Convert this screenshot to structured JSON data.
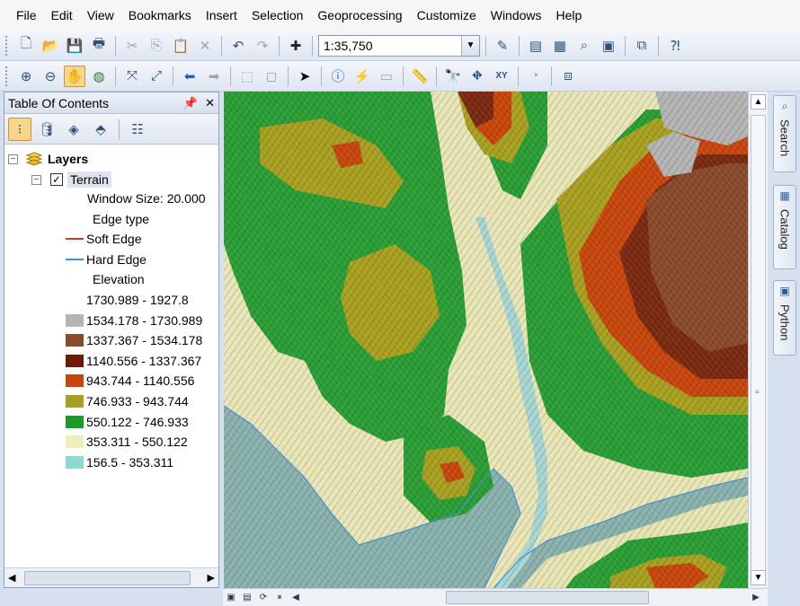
{
  "menu": [
    "File",
    "Edit",
    "View",
    "Bookmarks",
    "Insert",
    "Selection",
    "Geoprocessing",
    "Customize",
    "Windows",
    "Help"
  ],
  "toolbar": {
    "scale_value": "1:35,750",
    "icons_row1": [
      "new-icon",
      "open-icon",
      "save-icon",
      "print-icon",
      "cut-icon",
      "copy-icon",
      "paste-icon",
      "delete-icon",
      "undo-icon",
      "redo-icon",
      "add-data-icon"
    ],
    "icons_row2": [
      "zoom-in-icon",
      "zoom-out-icon",
      "pan-icon",
      "full-extent-icon",
      "fixed-zoom-in-icon",
      "fixed-zoom-out-icon",
      "back-extent-icon",
      "forward-extent-icon",
      "select-features-icon",
      "clear-selection-icon",
      "select-elements-icon",
      "identify-icon",
      "hyperlink-icon",
      "html-popup-icon",
      "measure-icon",
      "find-icon",
      "find-route-icon",
      "go-to-xy-icon",
      "time-slider-icon",
      "create-viewer-icon"
    ]
  },
  "toc": {
    "title": "Table Of Contents",
    "pin_label": "⌃",
    "close_label": "✕",
    "layers_label": "Layers",
    "layer_name": "Terrain",
    "window_size": "Window Size: 20.000",
    "edge_type_heading": "Edge type",
    "edges": [
      {
        "label": "Soft Edge",
        "color": "#d23a2a"
      },
      {
        "label": "Hard Edge",
        "color": "#4a8ed0"
      }
    ],
    "elevation_heading": "Elevation",
    "elevation_classes": [
      {
        "label": "1730.989 - 1927.8",
        "color": "#ffffff"
      },
      {
        "label": "1534.178 - 1730.989",
        "color": "#b4b4b4"
      },
      {
        "label": "1337.367 - 1534.178",
        "color": "#8a4a2c"
      },
      {
        "label": "1140.556 - 1337.367",
        "color": "#6e1a08"
      },
      {
        "label": "943.744 - 1140.556",
        "color": "#c8460c"
      },
      {
        "label": "746.933 - 943.744",
        "color": "#a8a020"
      },
      {
        "label": "550.122 - 746.933",
        "color": "#1e9a2a"
      },
      {
        "label": "353.311 - 550.122",
        "color": "#eeeebc"
      },
      {
        "label": "156.5 - 353.311",
        "color": "#8ed8d4"
      }
    ]
  },
  "side_tabs": [
    "Search",
    "Catalog",
    "Python"
  ],
  "colors": {
    "water": "#8ab2ad",
    "accent": "#f8d58a"
  }
}
